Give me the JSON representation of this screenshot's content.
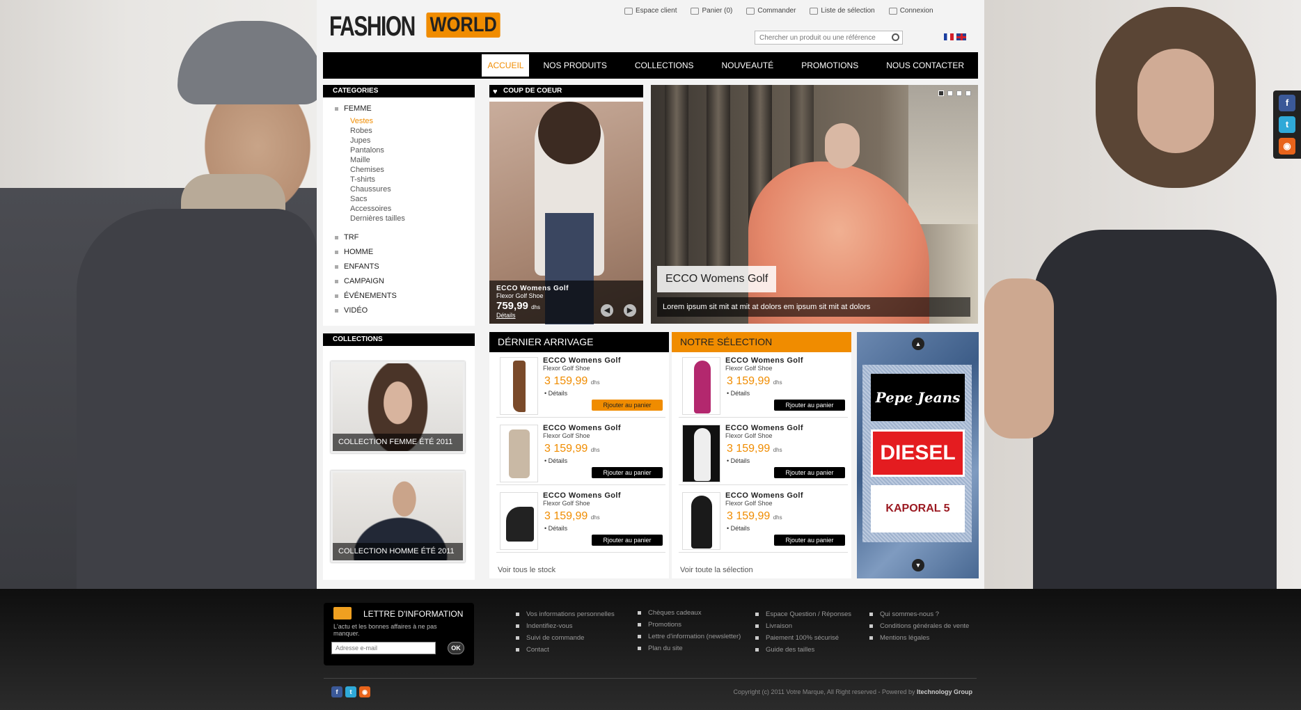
{
  "brand": {
    "logo_main": "FASHION",
    "logo_accent": "WORLD",
    "accent_color": "#f08c00"
  },
  "topnav": [
    {
      "label": "Espace client",
      "icon": "user-icon"
    },
    {
      "label": "Panier (0)",
      "icon": "cart-icon"
    },
    {
      "label": "Commander",
      "icon": "order-icon"
    },
    {
      "label": "Liste de sélection",
      "icon": "heart-icon"
    },
    {
      "label": "Connexion",
      "icon": "lock-icon"
    }
  ],
  "search": {
    "placeholder": "Chercher un produit ou une référence"
  },
  "mainnav": [
    "ACCUEIL",
    "NOS PRODUITS",
    "COLLECTIONS",
    "NOUVEAUTÉ",
    "PROMOTIONS",
    "NOUS CONTACTER"
  ],
  "categories": {
    "title": "CATEGORIES",
    "femme": "FEMME",
    "femme_sub": [
      "Vestes",
      "Robes",
      "Jupes",
      "Pantalons",
      "Maille",
      "Chemises",
      "T-shirts",
      "Chaussures",
      "Sacs",
      "Accessoires",
      "Dernières tailles"
    ],
    "others": [
      "TRF",
      "HOMME",
      "ENFANTS",
      "CAMPAIGN",
      "ÉVÉNEMENTS",
      "VIDÉO"
    ]
  },
  "collections": {
    "title": "COLLECTIONS",
    "femme": "COLLECTION FEMME ÉTÉ 2011",
    "homme": "COLLECTION HOMME ÉTÉ 2011"
  },
  "coup": {
    "title": "COUP DE COEUR",
    "name": "ECCO Womens Golf",
    "sub": "Flexor Golf Shoe",
    "price": "759,99",
    "currency": "dhs",
    "details": "Détails"
  },
  "slider": {
    "title": "ECCO Womens Golf",
    "desc": "Lorem ipsum sit mit at mit at dolors em ipsum sit mit at dolors"
  },
  "arrivage": {
    "title": "DÉRNIER ARRIVAGE",
    "more": "Voir tous le stock",
    "items": [
      {
        "name": "ECCO Womens Golf",
        "sub": "Flexor Golf Shoe",
        "price": "3 159,99",
        "currency": "dhs",
        "details": "• Détails",
        "button": "Rjouter au panier"
      },
      {
        "name": "ECCO Womens Golf",
        "sub": "Flexor Golf Shoe",
        "price": "3 159,99",
        "currency": "dhs",
        "details": "• Détails",
        "button": "Rjouter au panier"
      },
      {
        "name": "ECCO Womens Golf",
        "sub": "Flexor Golf Shoe",
        "price": "3 159,99",
        "currency": "dhs",
        "details": "• Détails",
        "button": "Rjouter au panier"
      }
    ]
  },
  "selection": {
    "title": "NOTRE SÉLECTION",
    "more": "Voir toute la sélection",
    "items": [
      {
        "name": "ECCO Womens Golf",
        "sub": "Flexor Golf Shoe",
        "price": "3 159,99",
        "currency": "dhs",
        "details": "• Détails",
        "button": "Rjouter au panier"
      },
      {
        "name": "ECCO Womens Golf",
        "sub": "Flexor Golf Shoe",
        "price": "3 159,99",
        "currency": "dhs",
        "details": "• Détails",
        "button": "Rjouter au panier"
      },
      {
        "name": "ECCO Womens Golf",
        "sub": "Flexor Golf Shoe",
        "price": "3 159,99",
        "currency": "dhs",
        "details": "• Détails",
        "button": "Rjouter au panier"
      }
    ]
  },
  "brands": [
    "Pepe Jeans",
    "DIESEL",
    "KAPORAL 5"
  ],
  "newsletter": {
    "title": "LETTRE D'INFORMATION",
    "desc": "L'actu et les bonnes affaires à ne pas manquer.",
    "placeholder": "Adresse e-mail",
    "ok": "OK"
  },
  "footer_cols": [
    [
      "Vos informations personnelles",
      "Indentifiez-vous",
      "Suivi de commande",
      "Contact"
    ],
    [
      "Chèques cadeaux",
      "Promotions",
      "Lettre d'information (newsletter)",
      "Plan du site"
    ],
    [
      "Espace Question / Réponses",
      "Livraison",
      "Paiement 100% sécurisé",
      "Guide des tailles"
    ],
    [
      "Qui sommes-nous ?",
      "Conditions générales de vente",
      "Mentions légales"
    ]
  ],
  "copyright": {
    "text": "Copyright (c) 2011 Votre Marque, All Right reserved - Powered by",
    "company": "Itechnology Group"
  }
}
